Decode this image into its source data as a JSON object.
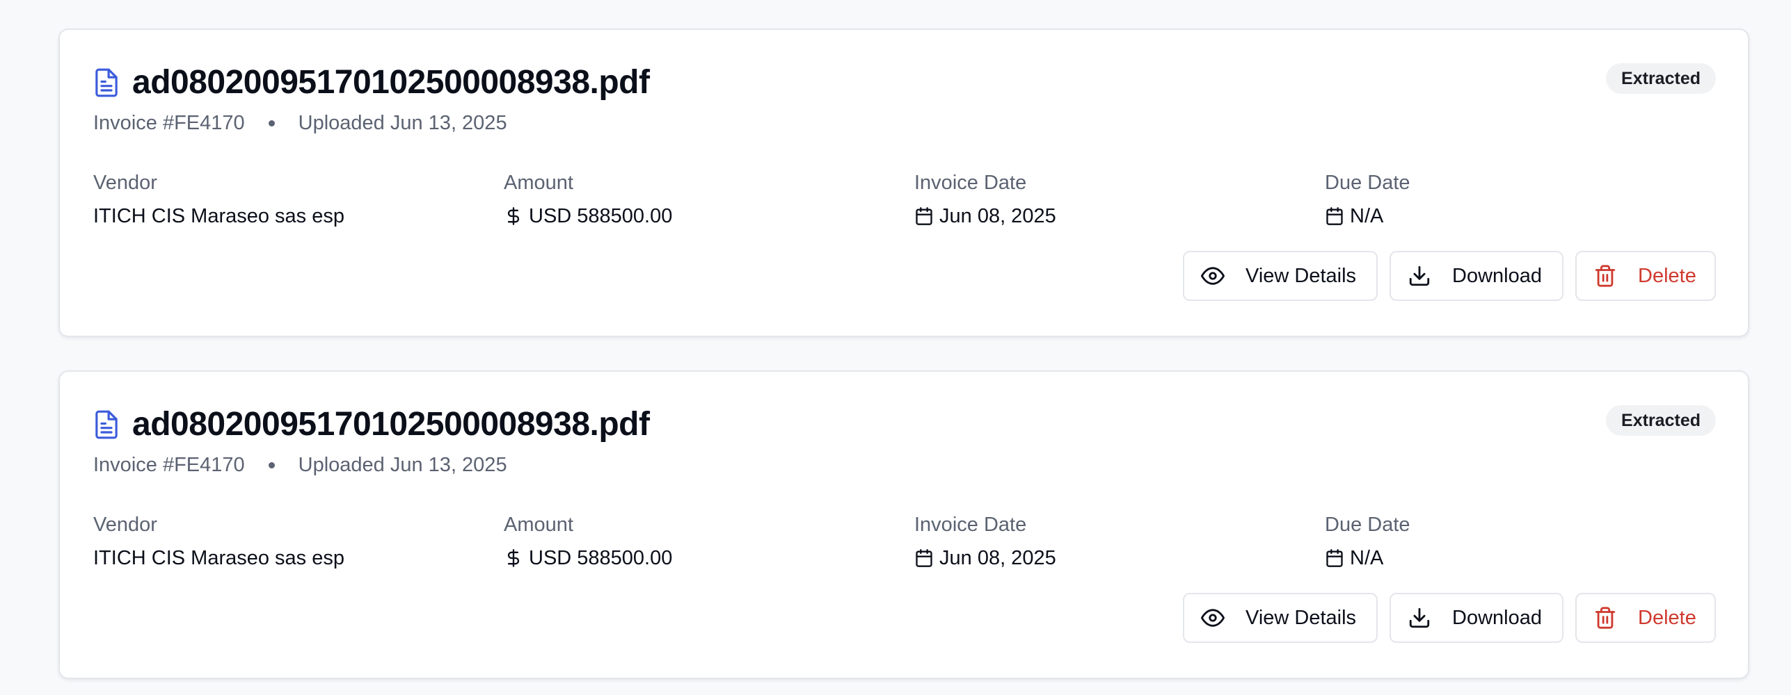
{
  "invoices": [
    {
      "file_name": "ad08020095170102500008938.pdf",
      "invoice_number": "Invoice #FE4170",
      "uploaded": "Uploaded Jun 13, 2025",
      "status": "Extracted",
      "vendor_label": "Vendor",
      "vendor": "ITICH CIS Maraseo sas esp",
      "amount_label": "Amount",
      "amount": "USD 588500.00",
      "invoice_date_label": "Invoice Date",
      "invoice_date": "Jun 08, 2025",
      "due_date_label": "Due Date",
      "due_date": "N/A",
      "view_label": "View Details",
      "download_label": "Download",
      "delete_label": "Delete"
    },
    {
      "file_name": "ad08020095170102500008938.pdf",
      "invoice_number": "Invoice #FE4170",
      "uploaded": "Uploaded Jun 13, 2025",
      "status": "Extracted",
      "vendor_label": "Vendor",
      "vendor": "ITICH CIS Maraseo sas esp",
      "amount_label": "Amount",
      "amount": "USD 588500.00",
      "invoice_date_label": "Invoice Date",
      "invoice_date": "Jun 08, 2025",
      "due_date_label": "Due Date",
      "due_date": "N/A",
      "view_label": "View Details",
      "download_label": "Download",
      "delete_label": "Delete"
    }
  ],
  "icons": {
    "file": "file-text-icon",
    "amount": "dollar-icon",
    "date": "calendar-icon",
    "view": "eye-icon",
    "download": "download-icon",
    "delete": "trash-icon"
  },
  "colors": {
    "file_icon": "#3b5bdb",
    "delete": "#cf3a2e",
    "badge_bg": "#f1f2f4",
    "muted_text": "#5b6271"
  }
}
